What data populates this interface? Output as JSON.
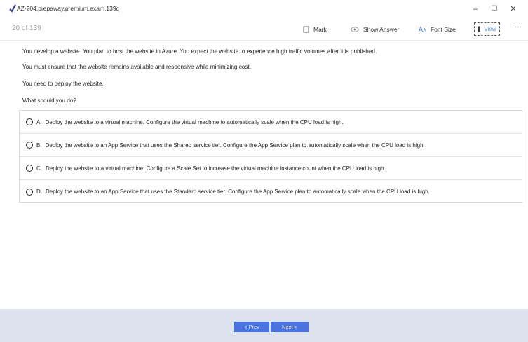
{
  "window": {
    "title": "AZ-204.prepaway.premium.exam.139q",
    "minimize": "–",
    "maximize": "☐",
    "close": "✕"
  },
  "toolbar": {
    "counter": "20 of 139",
    "mark": "Mark",
    "show_answer": "Show Answer",
    "font_size": "Font Size",
    "view": "View",
    "more": "···"
  },
  "question": {
    "lines": [
      "You develop a website. You plan to host the website in Azure. You expect the website to experience high traffic volumes after it is published.",
      "You must ensure that the website remains available and responsive while minimizing cost.",
      "You need to deploy the website.",
      "What should you do?"
    ]
  },
  "options": [
    {
      "letter": "A.",
      "text": "Deploy the website to a virtual machine. Configure the virtual machine to automatically scale when the CPU load is high."
    },
    {
      "letter": "B.",
      "text": "Deploy the website to an App Service that uses the Shared service tier. Configure the App Service plan to automatically scale when the CPU load is high."
    },
    {
      "letter": "C.",
      "text": "Deploy the website to a virtual machine. Configure a Scale Set to increase the virtual machine instance count when the CPU load is high."
    },
    {
      "letter": "D.",
      "text": "Deploy the website to an App Service that uses the Standard service tier. Configure the App Service plan to automatically scale when the CPU load is high."
    }
  ],
  "navigation": {
    "prev": "< Prev",
    "next": "Next >"
  },
  "colors": {
    "accent": "#4a73df",
    "footer": "#dce3ef",
    "counter": "#9aa1a8"
  }
}
